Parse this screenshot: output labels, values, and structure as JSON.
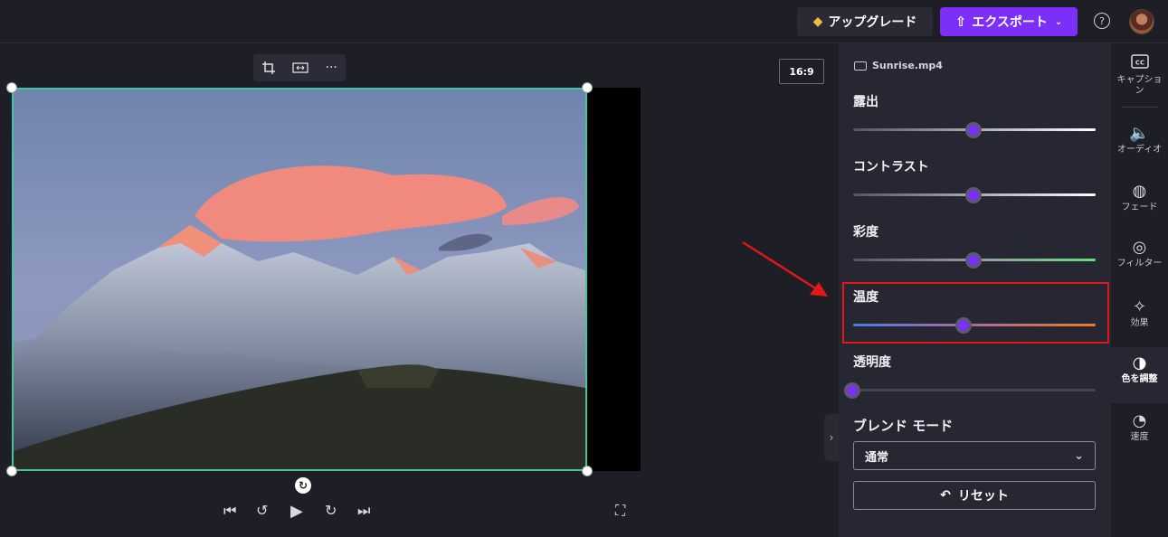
{
  "header": {
    "upgrade_label": "アップグレード",
    "export_label": "エクスポート"
  },
  "preview": {
    "aspect_ratio": "16:9"
  },
  "panel": {
    "file_name": "Sunrise.mp4",
    "sliders": [
      {
        "label": "露出",
        "value": 0.5
      },
      {
        "label": "コントラスト",
        "value": 0.5
      },
      {
        "label": "彩度",
        "value": 0.5
      },
      {
        "label": "温度",
        "value": 0.46
      },
      {
        "label": "透明度",
        "value": 0.0
      }
    ],
    "blend_mode_label": "ブレンド モード",
    "blend_mode_value": "通常",
    "reset_label": "リセット"
  },
  "rail": {
    "items": [
      {
        "label": "キャプション",
        "icon": "captions-icon"
      },
      {
        "label": "オーディオ",
        "icon": "audio-icon"
      },
      {
        "label": "フェード",
        "icon": "fade-icon"
      },
      {
        "label": "フィルター",
        "icon": "filter-icon"
      },
      {
        "label": "効果",
        "icon": "effects-icon"
      },
      {
        "label": "色を調整",
        "icon": "color-adjust-icon"
      },
      {
        "label": "速度",
        "icon": "speed-icon"
      }
    ]
  },
  "colors": {
    "accent": "#7b2ff7",
    "highlight": "#e01818",
    "selection": "#3fc7a4"
  }
}
